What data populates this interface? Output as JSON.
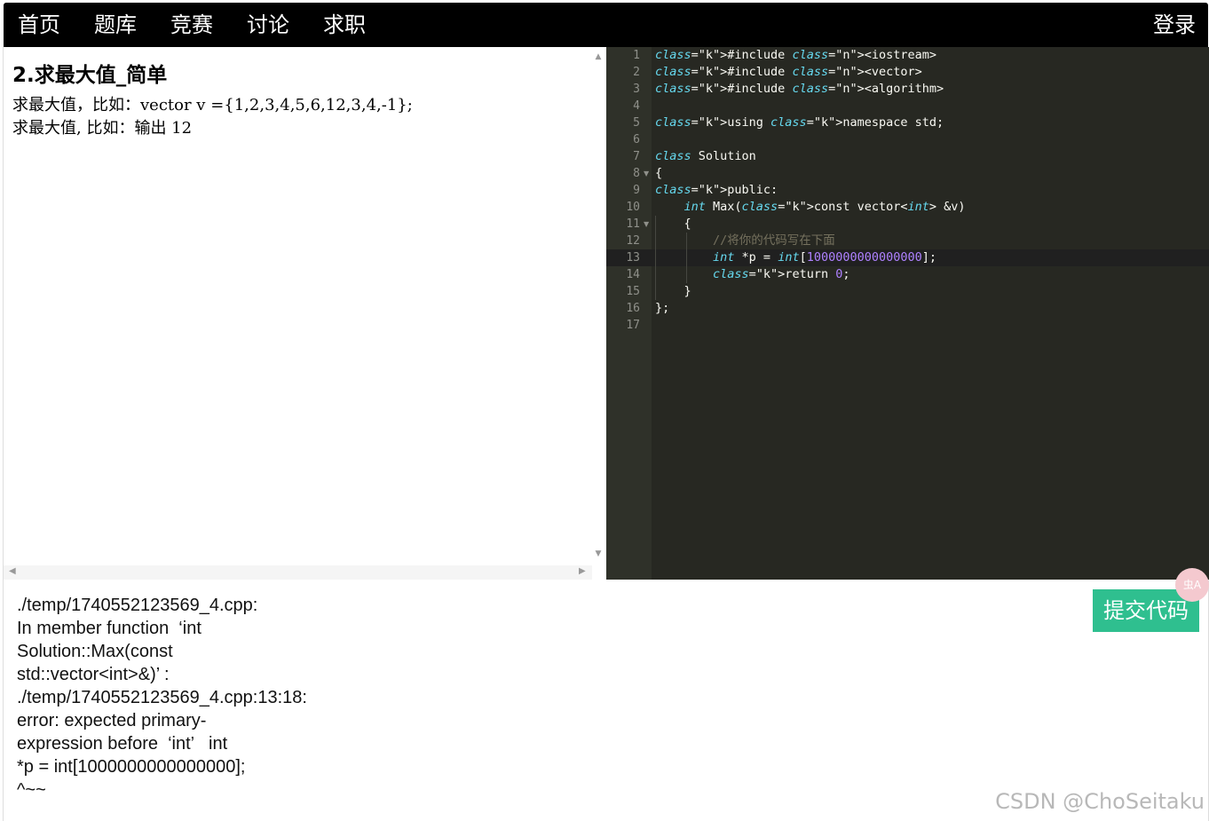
{
  "nav": {
    "items": [
      {
        "label": "首页"
      },
      {
        "label": "题库"
      },
      {
        "label": "竞赛"
      },
      {
        "label": "讨论"
      },
      {
        "label": "求职"
      }
    ],
    "login_label": "登录"
  },
  "problem": {
    "title": "2.求最大值_简单",
    "desc_line1": "求最大值，比如：vector v ={1,2,3,4,5,6,12,3,4,-1};",
    "desc_line2": "求最大值, 比如：输出 12"
  },
  "editor": {
    "line_numbers": [
      "1",
      "2",
      "3",
      "4",
      "5",
      "6",
      "7",
      "8",
      "9",
      "10",
      "11",
      "12",
      "13",
      "14",
      "15",
      "16",
      "17"
    ],
    "lines": [
      "#include <iostream>",
      "#include <vector>",
      "#include <algorithm>",
      "",
      "using namespace std;",
      "",
      "class Solution",
      "{",
      "public:",
      "    int Max(const vector<int> &v)",
      "    {",
      "        //将你的代码写在下面",
      "        int *p = int[1000000000000000];",
      "        return 0;",
      "    }",
      "};",
      ""
    ],
    "active_line": 13,
    "colors": {
      "background": "#272822",
      "keyword": "#f92672",
      "type": "#66d9ef",
      "number": "#ae81ff",
      "comment": "#75715e"
    }
  },
  "output": {
    "text": "./temp/1740552123569_4.cpp:\nIn member function  ‘int\nSolution::Max(const\nstd::vector<int>&)’ :\n./temp/1740552123569_4.cpp:13:18:\nerror: expected primary-\nexpression before  ‘int’   int\n*p = int[1000000000000000];\n^~~"
  },
  "submit_label": "提交代码",
  "badge_label": "虫A",
  "watermark": "CSDN @ChoSeitaku",
  "accent_color": "#2fbf8f"
}
